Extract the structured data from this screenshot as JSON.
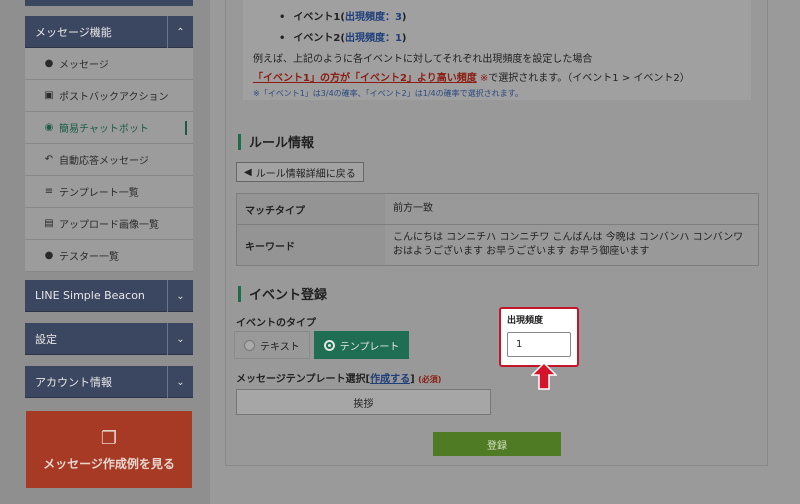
{
  "sidebar": {
    "message_feature": "メッセージ機能",
    "items": [
      {
        "icon": "speech-bubble-icon",
        "glyph": "●",
        "label": "メッセージ"
      },
      {
        "icon": "robot-icon",
        "glyph": "▣",
        "label": "ポストバックアクション"
      },
      {
        "icon": "chatbot-icon",
        "glyph": "◉",
        "label": "簡易チャットボット"
      },
      {
        "icon": "reply-icon",
        "glyph": "↶",
        "label": "自動応答メッセージ"
      },
      {
        "icon": "layers-icon",
        "glyph": "≡",
        "label": "テンプレート一覧"
      },
      {
        "icon": "images-icon",
        "glyph": "▤",
        "label": "アップロード画像一覧"
      },
      {
        "icon": "users-icon",
        "glyph": "●",
        "label": "テスター一覧"
      }
    ],
    "beacon": "LINE Simple Beacon",
    "settings": "設定",
    "account": "アカウント情報",
    "cta": "メッセージ作成例を見る"
  },
  "info": {
    "event1": "イベント1",
    "event1_freq": "出現頻度：3",
    "event2": "イベント2",
    "event2_freq": "出現頻度：1",
    "example": "例えば、上記のように各イベントに対してそれぞれ出現頻度を設定した場合",
    "emph": "「イベント1」の方が「イベント2」より高い頻度",
    "mark": "※",
    "tail": "で選択されます。（イベント1 > イベント2）",
    "note": "※「イベント1」は3/4の確率、「イベント2」は1/4の確率で選択されます。"
  },
  "rule": {
    "title": "ルール情報",
    "back": "ルール情報詳細に戻る",
    "match_label": "マッチタイプ",
    "match_value": "前方一致",
    "keyword_label": "キーワード",
    "keyword_value": "こんにちは コンニチハ コンニチワ こんばんは 今晩は コンバンハ コンバンワ おはようございます お早うございます お早う御座います"
  },
  "event": {
    "title": "イベント登録",
    "type_label": "イベントのタイプ",
    "opt_text": "テキスト",
    "opt_template": "テンプレート",
    "tmpl_label": "メッセージテンプレート選択",
    "tmpl_link": "作成する",
    "required": "(必須)",
    "tmpl_value": "挨拶",
    "freq_label": "出現頻度",
    "freq_value": "1",
    "submit": "登録"
  }
}
